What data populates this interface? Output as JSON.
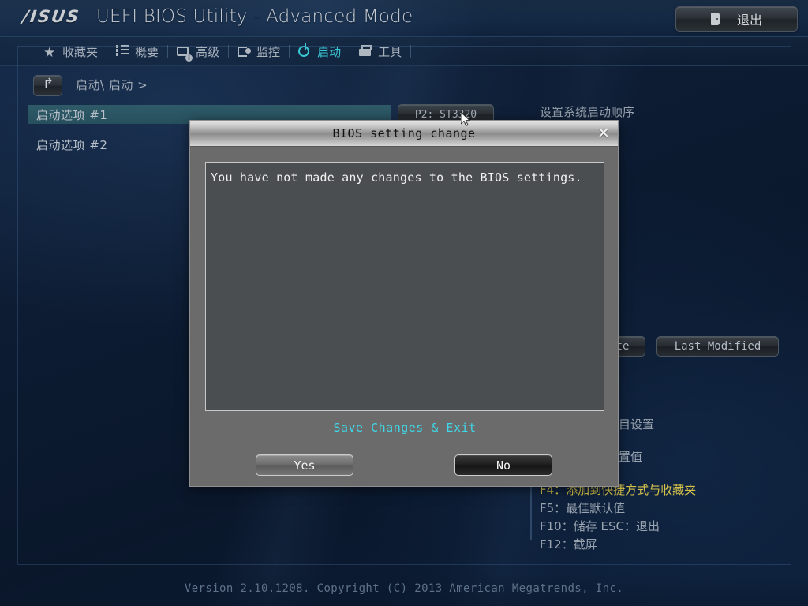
{
  "header": {
    "logo": "/ISUS",
    "title": "UEFI BIOS Utility - Advanced Mode",
    "exit_button": {
      "label": "退出",
      "icon": "exit-door-icon"
    }
  },
  "nav": {
    "items": [
      {
        "label": "收藏夹",
        "icon": "star-icon",
        "active": false
      },
      {
        "label": "概要",
        "icon": "list-icon",
        "active": false
      },
      {
        "label": "高级",
        "icon": "advanced-info-icon",
        "active": false
      },
      {
        "label": "监控",
        "icon": "monitor-gauge-icon",
        "active": false
      },
      {
        "label": "启动",
        "icon": "power-icon",
        "active": true
      },
      {
        "label": "工具",
        "icon": "toolbox-icon",
        "active": false
      }
    ]
  },
  "breadcrumb": {
    "back_icon": "back-arrow-icon",
    "path": "启动\\ 启动 >"
  },
  "boot_options": [
    {
      "label": "启动选项 #1",
      "value": "P2: ST3320",
      "selected": true
    },
    {
      "label": "启动选项 #2",
      "value": "",
      "selected": false
    }
  ],
  "help": {
    "description": "设置系统启动顺序"
  },
  "right_buttons": [
    {
      "label": "te",
      "name": "last-update-button"
    },
    {
      "label": "Last Modified",
      "name": "last-modified-button"
    }
  ],
  "hotkeys": [
    {
      "text": "F4：添加到快捷方式与收藏夹",
      "highlight": true
    },
    {
      "text": "F5：最佳默认值",
      "highlight": false
    },
    {
      "text": "F10：储存  ESC：退出",
      "highlight": false
    },
    {
      "text": "F12：截屏",
      "highlight": false
    }
  ],
  "obscured_help_lines": [
    "目设置",
    "置值"
  ],
  "dialog": {
    "title": "BIOS setting change",
    "close_icon": "close-icon",
    "message": "You have not made any changes to the BIOS settings.",
    "action_label": "Save Changes & Exit",
    "buttons": {
      "yes": "Yes",
      "no": "No"
    }
  },
  "footer": {
    "version": "Version 2.10.1208. Copyright (C) 2013 American Megatrends, Inc."
  },
  "colors": {
    "accent_cyan": "#39c9d6",
    "highlight_row": "#2f5a68",
    "hotkey_yellow": "#d8c34a",
    "dialog_gray": "#6b6b6b",
    "dialog_body": "#4b4e50"
  }
}
